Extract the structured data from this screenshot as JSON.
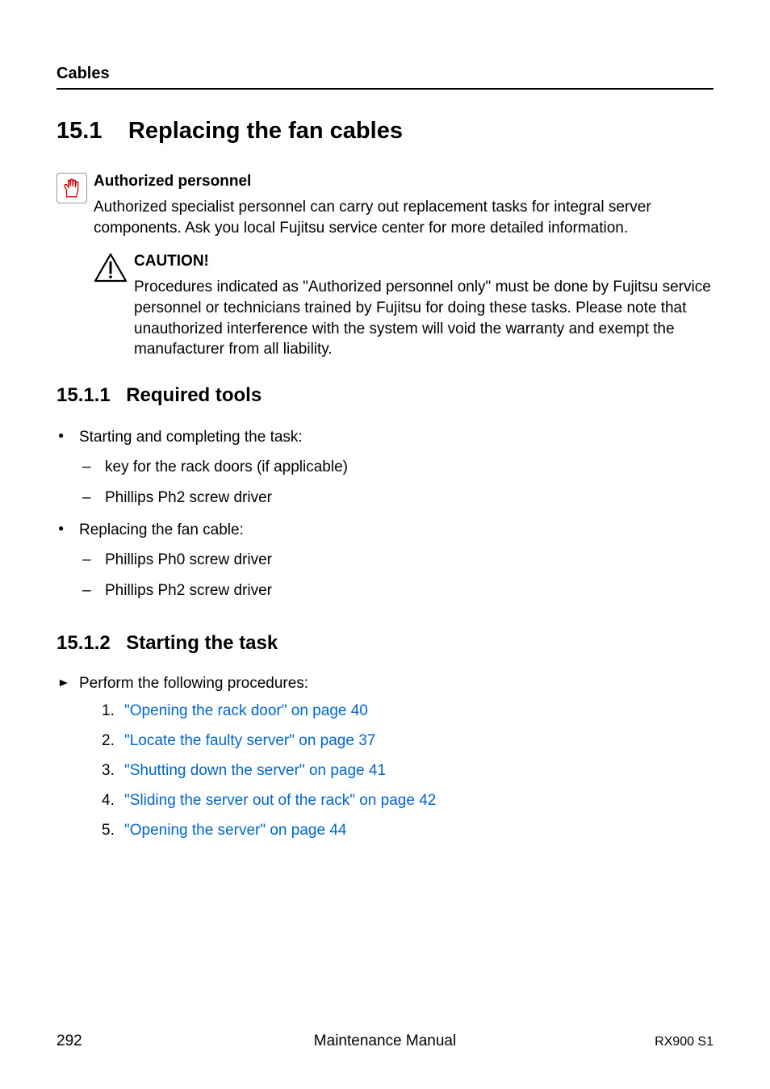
{
  "header": {
    "category": "Cables"
  },
  "section": {
    "number": "15.1",
    "title": "Replacing the fan cables"
  },
  "info": {
    "label": "Authorized personnel",
    "text": "Authorized specialist personnel can carry out replacement tasks for integral server components. Ask you local Fujitsu service center for more detailed information."
  },
  "caution": {
    "label": "CAUTION!",
    "text": "Procedures indicated as \"Authorized personnel only\" must be done by Fujitsu service personnel or technicians trained by Fujitsu for doing these tasks. Please note that unauthorized interference with the system will void the warranty and exempt the manufacturer from all liability."
  },
  "sub1": {
    "number": "15.1.1",
    "title": "Required tools",
    "bullets": [
      {
        "text": "Starting and completing the task:",
        "sub": [
          "key for the rack doors (if applicable)",
          "Phillips Ph2 screw driver"
        ]
      },
      {
        "text": " Replacing the fan cable:",
        "sub": [
          "Phillips Ph0 screw driver",
          "Phillips Ph2 screw driver"
        ]
      }
    ]
  },
  "sub2": {
    "number": "15.1.2",
    "title": "Starting the task",
    "lead": "Perform the following procedures:",
    "steps": [
      "\"Opening the rack door\" on page 40",
      "\"Locate the faulty server\" on page 37",
      "\"Shutting down the server\" on page 41",
      "\"Sliding the server out of the rack\" on page 42",
      "\"Opening the server\" on page 44"
    ]
  },
  "footer": {
    "page": "292",
    "center": "Maintenance Manual",
    "right": "RX900 S1"
  }
}
